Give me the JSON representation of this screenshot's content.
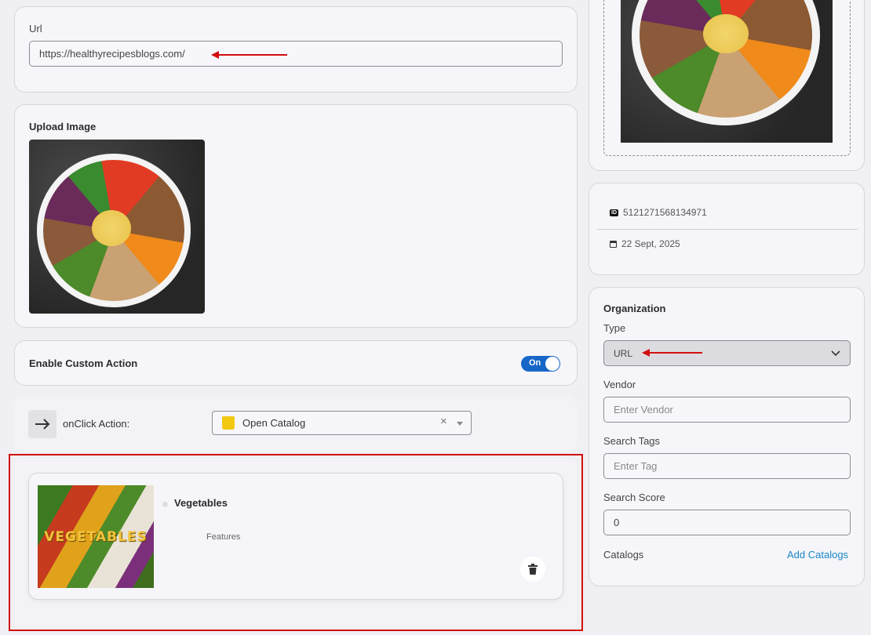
{
  "url_section": {
    "label": "Url",
    "value": "https://healthyrecipesblogs.com/"
  },
  "upload_section": {
    "label": "Upload Image"
  },
  "custom_action": {
    "label": "Enable Custom Action",
    "toggle_label": "On"
  },
  "onclick": {
    "label": "onClick Action:",
    "selected": "Open Catalog",
    "clear_glyph": "×"
  },
  "catalog_item": {
    "image_text": "VEGETABLES",
    "title": "Vegetables",
    "subtitle": "Features"
  },
  "meta": {
    "id_icon": "ID",
    "id_value": "5121271568134971",
    "date_value": "22 Sept, 2025"
  },
  "organization": {
    "title": "Organization",
    "type_label": "Type",
    "type_value": "URL",
    "vendor_label": "Vendor",
    "vendor_placeholder": "Enter Vendor",
    "tags_label": "Search Tags",
    "tags_placeholder": "Enter Tag",
    "score_label": "Search Score",
    "score_value": "0",
    "catalogs_label": "Catalogs",
    "add_catalogs": "Add Catalogs"
  },
  "colors": {
    "accent": "#1766c8",
    "highlight": "#d10f0f",
    "link": "#1a86c7"
  }
}
